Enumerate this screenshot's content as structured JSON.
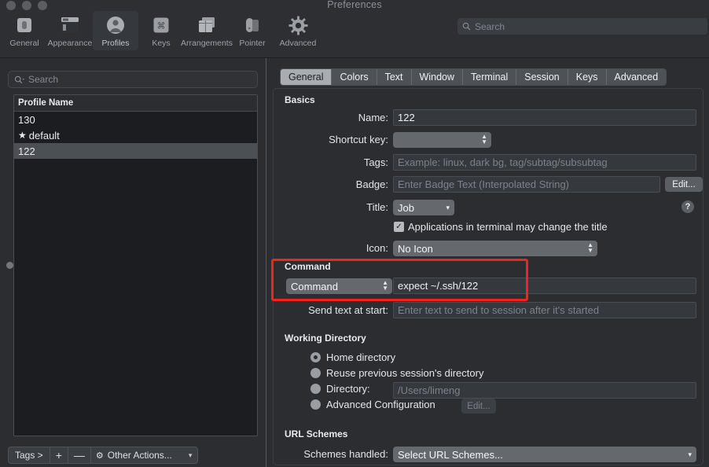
{
  "window": {
    "title": "Preferences"
  },
  "toolbar": {
    "items": [
      {
        "label": "General",
        "icon": "general-icon"
      },
      {
        "label": "Appearance",
        "icon": "appearance-icon"
      },
      {
        "label": "Profiles",
        "icon": "profiles-icon"
      },
      {
        "label": "Keys",
        "icon": "keys-icon"
      },
      {
        "label": "Arrangements",
        "icon": "arrangements-icon"
      },
      {
        "label": "Pointer",
        "icon": "pointer-icon"
      },
      {
        "label": "Advanced",
        "icon": "advanced-icon"
      }
    ],
    "selected": "Profiles",
    "search_placeholder": "Search"
  },
  "sidebar": {
    "search_placeholder": "Search",
    "column_header": "Profile Name",
    "profiles": [
      {
        "name": "130",
        "starred": false,
        "selected": false
      },
      {
        "name": "default",
        "starred": true,
        "selected": false
      },
      {
        "name": "122",
        "starred": false,
        "selected": true
      }
    ],
    "bottom_toolbar": {
      "tags_label": "Tags >",
      "add_label": "+",
      "remove_label": "—",
      "other_actions_label": "Other Actions...",
      "gear_icon": "gear-icon",
      "caret_icon": "chevron-down-icon"
    }
  },
  "panel": {
    "tabs": [
      {
        "label": "General",
        "selected": true
      },
      {
        "label": "Colors",
        "selected": false
      },
      {
        "label": "Text",
        "selected": false
      },
      {
        "label": "Window",
        "selected": false
      },
      {
        "label": "Terminal",
        "selected": false
      },
      {
        "label": "Session",
        "selected": false
      },
      {
        "label": "Keys",
        "selected": false
      },
      {
        "label": "Advanced",
        "selected": false
      }
    ],
    "basics": {
      "heading": "Basics",
      "name_label": "Name:",
      "name_value": "122",
      "shortcut_label": "Shortcut key:",
      "shortcut_value": "",
      "tags_label": "Tags:",
      "tags_placeholder": "Example: linux, dark bg, tag/subtag/subsubtag",
      "badge_label": "Badge:",
      "badge_placeholder": "Enter Badge Text (Interpolated String)",
      "badge_edit_label": "Edit...",
      "title_label": "Title:",
      "title_value": "Job",
      "help_label": "?",
      "app_title_checkbox_label": "Applications in terminal may change the title",
      "app_title_checkbox_checked": true,
      "icon_label": "Icon:",
      "icon_value": "No Icon"
    },
    "command": {
      "heading": "Command",
      "mode_value": "Command",
      "command_value": "expect ~/.ssh/122",
      "send_text_label": "Send text at start:",
      "send_text_placeholder": "Enter text to send to session after it's started"
    },
    "working_directory": {
      "heading": "Working Directory",
      "options": [
        {
          "label": "Home directory",
          "selected": true
        },
        {
          "label": "Reuse previous session's directory",
          "selected": false
        },
        {
          "label": "Directory:",
          "selected": false
        },
        {
          "label": "Advanced Configuration",
          "selected": false
        }
      ],
      "directory_placeholder": "/Users/limeng",
      "advanced_edit_label": "Edit..."
    },
    "url_schemes": {
      "heading": "URL Schemes",
      "schemes_label": "Schemes handled:",
      "schemes_value": "Select URL Schemes..."
    }
  },
  "annotation": {
    "highlight_color": "#f5231d"
  }
}
